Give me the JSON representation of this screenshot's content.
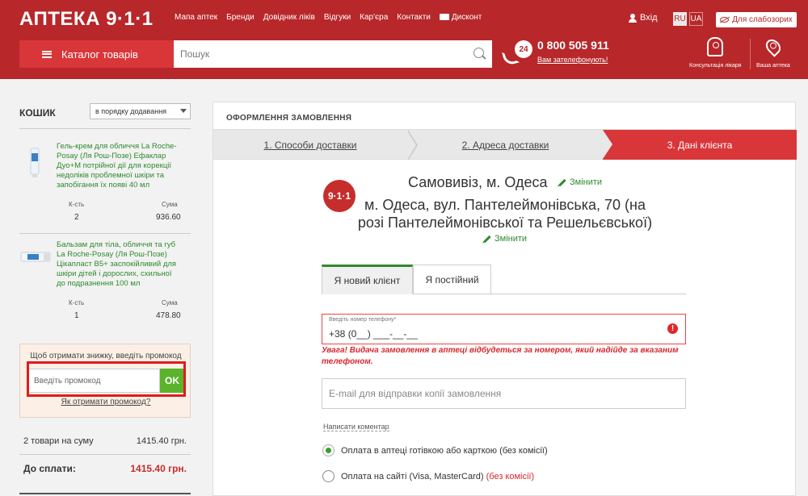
{
  "header": {
    "logo": "АПТЕКА 9·1·1",
    "nav": [
      "Мапа аптек",
      "Бренди",
      "Довідник ліків",
      "Відгуки",
      "Кар'єра",
      "Контакти",
      "Дисконт"
    ],
    "login": "Вхід",
    "lang_ru": "RU",
    "lang_ua": "UA",
    "vision_btn": "Для слабозорих",
    "catalog_btn": "Каталог товарів",
    "search_placeholder": "Пошук",
    "phone_badge": "24",
    "phone": "0 800 505 911",
    "callback": "Вам зателефонують!",
    "doctor": "Консультація лікаря",
    "pharmacy": "Ваша аптека"
  },
  "cart": {
    "title": "КОШИК",
    "sort": "в порядку додавання",
    "qty_label": "К-сть",
    "sum_label": "Сума",
    "items": [
      {
        "name": "Гель-крем для обличчя La Roche-Posay (Ля Рош-Позе) Ефаклар Дуо+M потрійної дії для корекції недоліків проблемної шкіри та запобігання їх появі 40 мл",
        "qty": "2",
        "sum": "936.60"
      },
      {
        "name": "Бальзам для тіла, обличчя та губ La Roche-Posay (Ля Рош-Позе) Цікапласт B5+ заспокійливий для шкіри дітей і дорослих, схильної до подразнення 100 мл",
        "qty": "1",
        "sum": "478.80"
      }
    ],
    "promo_hint": "Щоб отримати знижку, введіть промокод",
    "promo_placeholder": "Введіть промокод",
    "promo_ok": "OK",
    "promo_link": "Як отримати промокод?",
    "subtotal_label": "2 товари на суму",
    "subtotal_value": "1415.40 грн.",
    "total_label": "До сплати:",
    "total_value": "1415.40 грн."
  },
  "order": {
    "title": "ОФОРМЛЕННЯ ЗАМОВЛЕННЯ",
    "steps": [
      "1. Способи доставки",
      "2. Адреса доставки",
      "3. Дані клієнта"
    ],
    "logo": "9·1·1",
    "pickup": "Самовивіз, м. Одеса",
    "change": "Змінити",
    "address": "м. Одеса, вул. Пантелеймонівська, 70 (на розі Пантелеймонівської та Решельєвської)",
    "tabs": [
      "Я новий клієнт",
      "Я постійний"
    ],
    "phone_label": "Введіть номер телефону*",
    "phone_value": "+38 (0__) ___-__-__",
    "error_icon": "!",
    "warning": "Увага! Видача замовлення в аптеці відбудеться за номером, який надійде за вказаним телефоном.",
    "email_placeholder": "E-mail для відправки копії замовлення",
    "comment": "Написати коментар",
    "pay_cash": "Оплата в аптеці готівкою або карткою (без комісії)",
    "pay_site": "Оплата на сайті (Visa, MasterCard)",
    "pay_site_fee": "(без комісії)"
  }
}
